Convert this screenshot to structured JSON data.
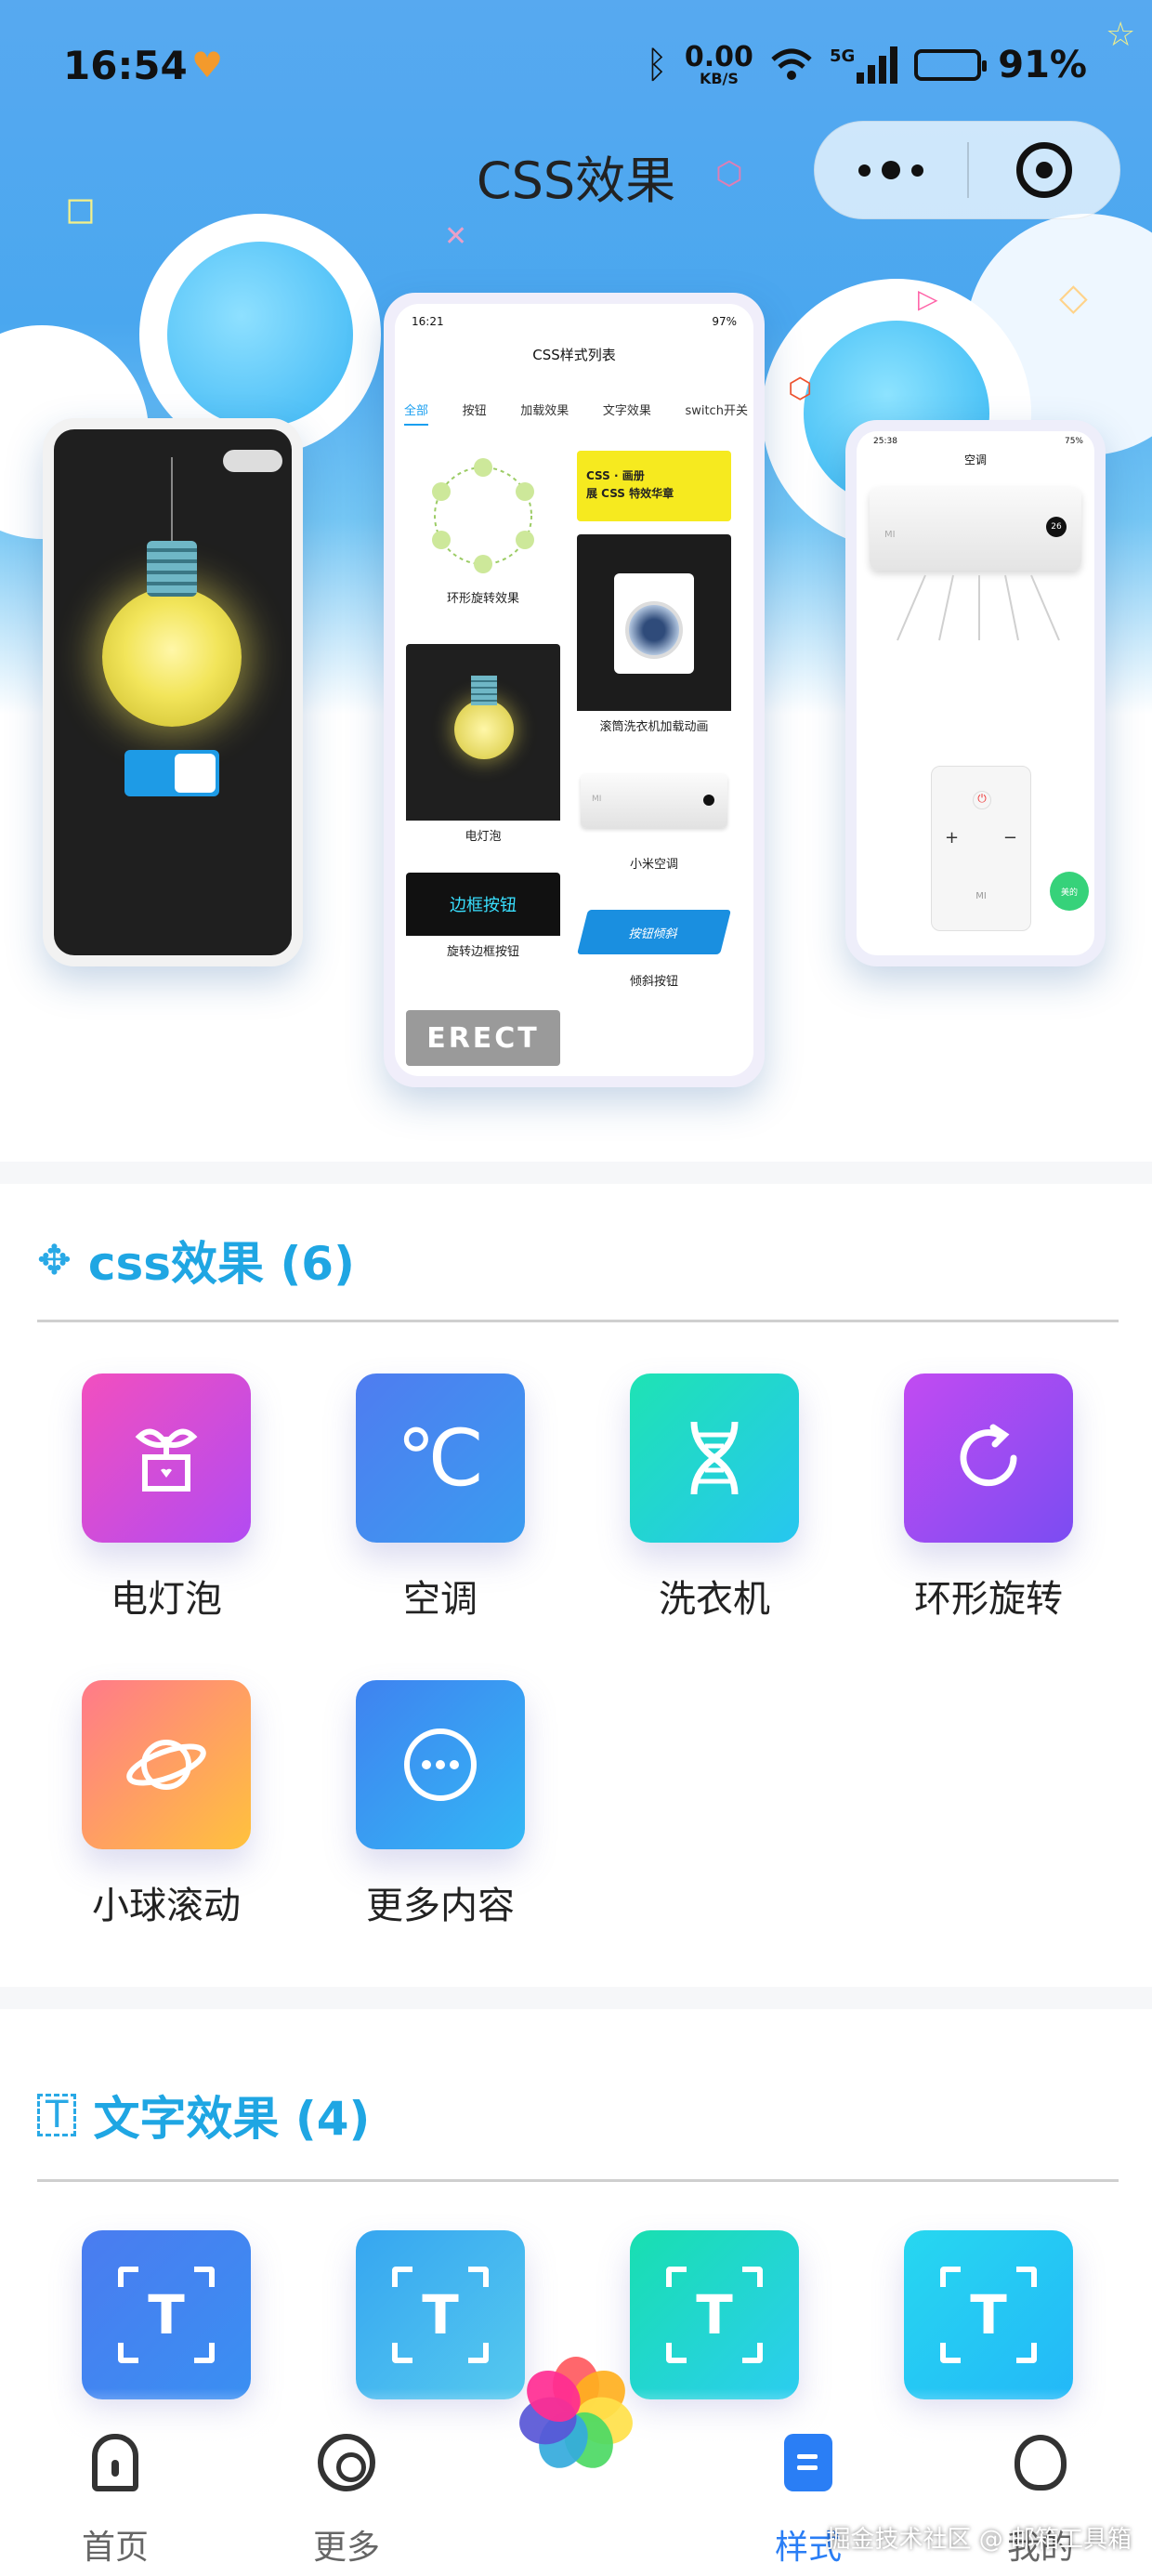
{
  "status_bar": {
    "time": "16:54",
    "net_speed": "0.00",
    "net_unit": "KB/S",
    "signal": "5G",
    "battery": "91%"
  },
  "nav": {
    "title": "CSS效果"
  },
  "preview": {
    "center_phone": {
      "time": "16:21",
      "battery": "97%",
      "title": "CSS样式列表",
      "tabs": [
        "全部",
        "按钮",
        "加载效果",
        "文字效果",
        "switch开关"
      ],
      "cards": {
        "ring": "环形旋转效果",
        "banner_line1": "CSS · 画册",
        "banner_line2": "展 CSS 特效华章",
        "washer": "滚筒洗衣机加载动画",
        "bulb": "电灯泡",
        "ac": "小米空调",
        "border_btn_text": "边框按钮",
        "border_btn": "旋转边框按钮",
        "tilt_btn_text": "按钮倾斜",
        "tilt_btn": "倾斜按钮",
        "erect": "ERECT",
        "ac_brand": "MI"
      }
    },
    "right_phone": {
      "time": "25:38",
      "battery": "75%",
      "title": "空调",
      "ac_brand": "MI",
      "temp": "26",
      "remote_brand": "MI",
      "go_button": "美的"
    }
  },
  "css_section": {
    "title": "css效果 (6)",
    "items": [
      {
        "label": "电灯泡",
        "icon": "plant-pot-icon",
        "gradient": "#f24fbf"
      },
      {
        "label": "空调",
        "icon": "celsius-icon",
        "gradient": "#4f7cf0"
      },
      {
        "label": "洗衣机",
        "icon": "dna-icon",
        "gradient": "#1ee3b4"
      },
      {
        "label": "环形旋转",
        "icon": "rotate-icon",
        "gradient": "#c24bf2"
      },
      {
        "label": "小球滚动",
        "icon": "planet-icon",
        "gradient": "#ff7a8a"
      },
      {
        "label": "更多内容",
        "icon": "more-circle-icon",
        "gradient": "#3f82f0"
      }
    ]
  },
  "text_section": {
    "title": "文字效果 (4)",
    "items": [
      {
        "icon": "text-frame-icon"
      },
      {
        "icon": "text-frame-icon"
      },
      {
        "icon": "text-frame-icon"
      },
      {
        "icon": "text-frame-icon"
      }
    ]
  },
  "tabbar": {
    "items": [
      {
        "label": "首页",
        "icon": "home-icon"
      },
      {
        "label": "更多",
        "icon": "more-icon"
      },
      {
        "label": "样式",
        "icon": "style-icon",
        "active": true
      },
      {
        "label": "我的",
        "icon": "mine-icon"
      }
    ]
  },
  "watermark": "掘金技术社区 @ 邮箱工具箱",
  "colors": {
    "accent": "#1fa6e3",
    "tab_active": "#2a7ef5",
    "hero_top": "#57a9f0"
  }
}
